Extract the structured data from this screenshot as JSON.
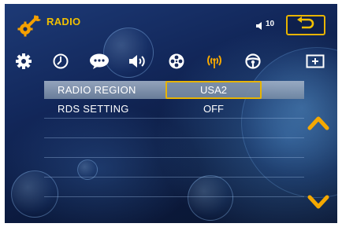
{
  "header": {
    "title": "RADIO",
    "app_icon": "wrench-gear-icon",
    "volume_icon": "speaker-icon",
    "volume_value": "10",
    "back_icon": "return-arrow-icon",
    "accent_color": "#f2c000"
  },
  "tabs": [
    {
      "icon": "gear-icon",
      "selected": false
    },
    {
      "icon": "clock-icon",
      "selected": false
    },
    {
      "icon": "speech-bubble-icon",
      "selected": false
    },
    {
      "icon": "speaker-volume-icon",
      "selected": false
    },
    {
      "icon": "film-reel-icon",
      "selected": false
    },
    {
      "icon": "radio-antenna-icon",
      "selected": true
    },
    {
      "icon": "steering-wheel-icon",
      "selected": false
    },
    {
      "icon": "plus-screen-icon",
      "selected": false
    }
  ],
  "settings": {
    "rows": [
      {
        "label": "RADIO  REGION",
        "value": "USA2",
        "selected": true
      },
      {
        "label": "RDS  SETTING",
        "value": "OFF",
        "selected": false
      }
    ]
  },
  "scroll": {
    "up_icon": "chevron-up-icon",
    "down_icon": "chevron-down-icon",
    "color": "#f5a800"
  }
}
